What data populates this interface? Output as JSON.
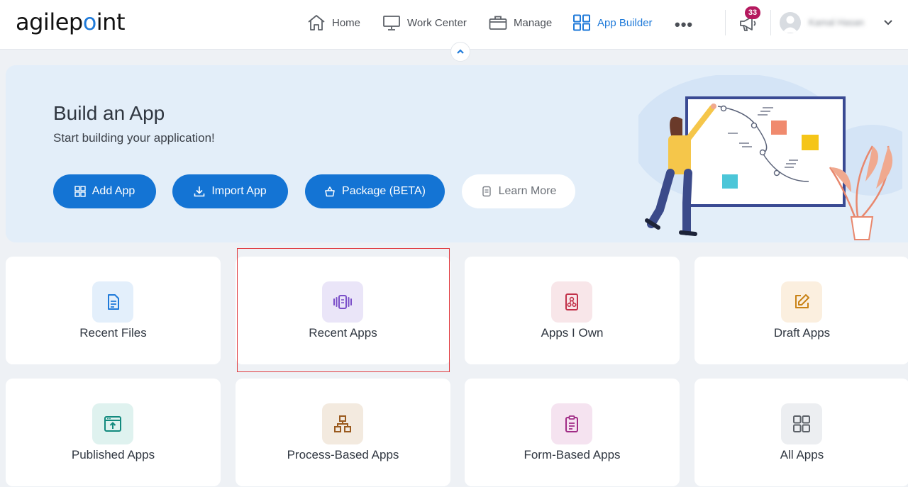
{
  "brand": {
    "logo_text": "agilepoint",
    "accent": "#1f7ad9"
  },
  "nav": {
    "home": "Home",
    "work_center": "Work Center",
    "manage": "Manage",
    "app_builder": "App Builder",
    "more_icon": "ellipsis-icon"
  },
  "notifications": {
    "count": "33"
  },
  "user": {
    "name": "Kamal Hasan"
  },
  "hero": {
    "title": "Build an App",
    "subtitle": "Start building your application!",
    "buttons": {
      "add_app": "Add App",
      "import_app": "Import App",
      "package": "Package (BETA)",
      "learn_more": "Learn More"
    }
  },
  "tiles": [
    {
      "label": "Recent Files",
      "icon": "document-icon",
      "color": "#1f7ad9",
      "bg": "#e3effb"
    },
    {
      "label": "Recent Apps",
      "icon": "app-carousel-icon",
      "color": "#7b4fc9",
      "bg": "#eae5f8"
    },
    {
      "label": "Apps I Own",
      "icon": "owned-app-icon",
      "color": "#c2324a",
      "bg": "#f8e6e9"
    },
    {
      "label": "Draft Apps",
      "icon": "edit-icon",
      "color": "#c98317",
      "bg": "#fbefdf"
    },
    {
      "label": "Published Apps",
      "icon": "publish-icon",
      "color": "#138a7e",
      "bg": "#dff2ef"
    },
    {
      "label": "Process-Based Apps",
      "icon": "process-icon",
      "color": "#9a5a1e",
      "bg": "#f3eadf"
    },
    {
      "label": "Form-Based Apps",
      "icon": "form-icon",
      "color": "#a12c86",
      "bg": "#f5e3f0"
    },
    {
      "label": "All Apps",
      "icon": "grid-icon",
      "color": "#5c6168",
      "bg": "#eceef1"
    }
  ],
  "highlight": {
    "color": "#e0393e",
    "target": "Recent Apps"
  }
}
